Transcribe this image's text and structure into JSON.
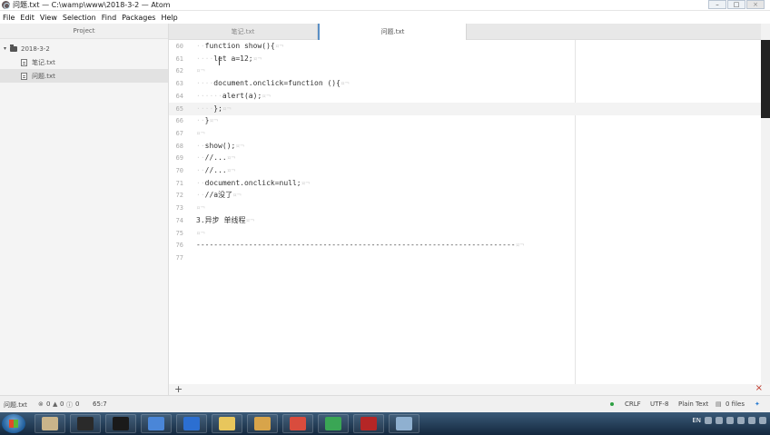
{
  "window": {
    "title": "问题.txt — C:\\wamp\\www\\2018-3-2 — Atom"
  },
  "window_controls": {
    "minimize": "–",
    "maximize": "□",
    "close": "×"
  },
  "menu": [
    "File",
    "Edit",
    "View",
    "Selection",
    "Find",
    "Packages",
    "Help"
  ],
  "tree": {
    "panel_title": "Project",
    "folder": "2018-3-2",
    "files": [
      "笔记.txt",
      "问题.txt"
    ],
    "selected_file": "问题.txt"
  },
  "tabs": [
    {
      "label": "笔记.txt",
      "active": false
    },
    {
      "label": "问题.txt",
      "active": true
    }
  ],
  "editor": {
    "cursor_line": 65,
    "lines": [
      {
        "n": "60",
        "indent": "··",
        "text": "function show(){",
        "eol": "¤¬"
      },
      {
        "n": "61",
        "indent": "····",
        "text": "let a=12;",
        "eol": "¤¬"
      },
      {
        "n": "62",
        "indent": "",
        "text": "",
        "eol": "¤¬"
      },
      {
        "n": "63",
        "indent": "····",
        "text": "document.onclick=function (){",
        "eol": "¤¬"
      },
      {
        "n": "64",
        "indent": "······",
        "text": "alert(a);",
        "eol": "¤¬"
      },
      {
        "n": "65",
        "indent": "····",
        "text": "};",
        "eol": "¤¬"
      },
      {
        "n": "66",
        "indent": "··",
        "text": "}",
        "eol": "¤¬"
      },
      {
        "n": "67",
        "indent": "",
        "text": "",
        "eol": "¤¬"
      },
      {
        "n": "68",
        "indent": "··",
        "text": "show();",
        "eol": "¤¬"
      },
      {
        "n": "69",
        "indent": "··",
        "text": "//...",
        "eol": "¤¬"
      },
      {
        "n": "70",
        "indent": "··",
        "text": "//...",
        "eol": "¤¬"
      },
      {
        "n": "71",
        "indent": "··",
        "text": "document.onclick=null;",
        "eol": "¤¬"
      },
      {
        "n": "72",
        "indent": "··",
        "text": "//a没了",
        "eol": "¤¬"
      },
      {
        "n": "73",
        "indent": "",
        "text": "",
        "eol": "¤¬"
      },
      {
        "n": "74",
        "indent": "",
        "text": "3.异步 单线程",
        "eol": "¤¬"
      },
      {
        "n": "75",
        "indent": "",
        "text": "",
        "eol": "¤¬"
      },
      {
        "n": "76",
        "indent": "",
        "text": "-------------------------------------------------------------------------",
        "eol": "¤¬"
      },
      {
        "n": "77",
        "indent": "",
        "text": "",
        "eol": ""
      }
    ]
  },
  "bottom_panel": {
    "add": "+",
    "close": "×"
  },
  "status": {
    "file": "问题.txt",
    "errors": "0",
    "warnings": "0",
    "info": "0",
    "position": "65:7",
    "line_ending": "CRLF",
    "encoding": "UTF-8",
    "grammar": "Plain Text",
    "files": "0 files"
  },
  "taskbar": {
    "apps": [
      {
        "name": "file-manager-icon",
        "color": "#c9b48a"
      },
      {
        "name": "cursor-app-icon",
        "color": "#2a2a2a"
      },
      {
        "name": "screen-app-icon",
        "color": "#1a1a1a"
      },
      {
        "name": "translate-app-icon",
        "color": "#4a86d8"
      },
      {
        "name": "sigma-app-icon",
        "color": "#2c6fd1"
      },
      {
        "name": "folder-app-icon",
        "color": "#e8c65c"
      },
      {
        "name": "media-app-icon",
        "color": "#d8a44a"
      },
      {
        "name": "chrome-icon",
        "color": "#d94c3d"
      },
      {
        "name": "sync-app-icon",
        "color": "#3aa655"
      },
      {
        "name": "video-app-icon",
        "color": "#b52626"
      },
      {
        "name": "paint-app-icon",
        "color": "#8fb0d0"
      }
    ],
    "tray_text": "EN"
  }
}
